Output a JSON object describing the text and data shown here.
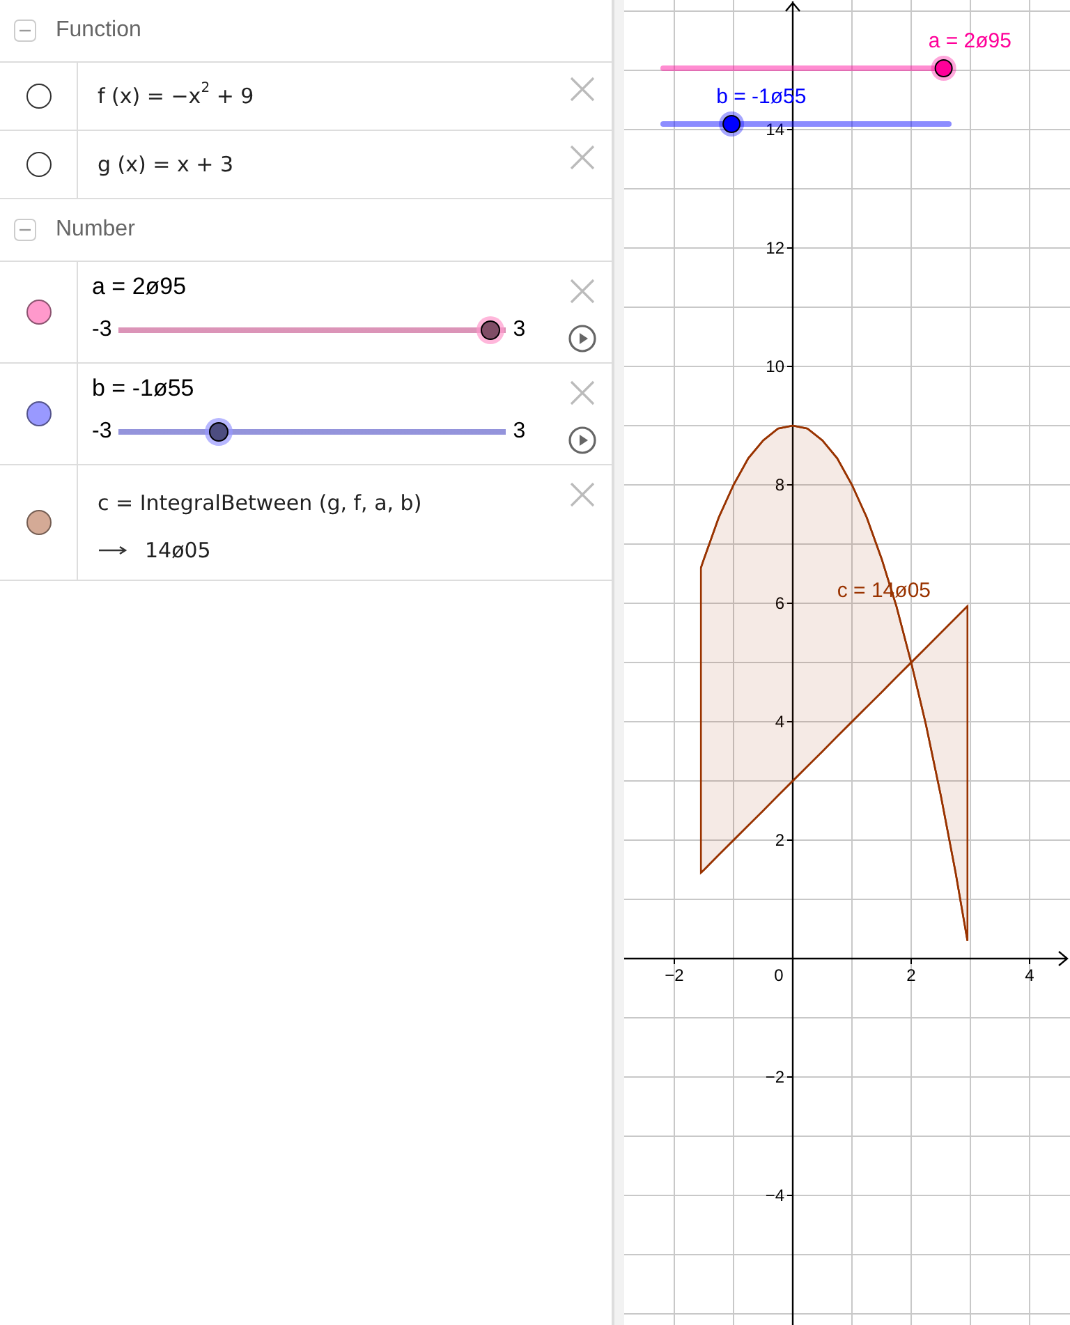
{
  "algebra": {
    "groups": [
      {
        "title": "Function",
        "expanded": true,
        "items": [
          {
            "kind": "function",
            "visible": false,
            "formula": "f (x) = −x$^{2}$ + 9"
          },
          {
            "kind": "function",
            "visible": false,
            "formula": "g (x) = x + 3"
          }
        ]
      },
      {
        "title": "Number",
        "expanded": true,
        "items": [
          {
            "kind": "slider",
            "visible": true,
            "color": "#ff99cc",
            "label": "a = 2ø95",
            "min": "-3",
            "max": "3",
            "level": 0.9917
          },
          {
            "kind": "slider",
            "visible": true,
            "color": "#9999ff",
            "label": "b = -1ø55",
            "min": "-3",
            "max": "3",
            "level": 0.2417
          },
          {
            "kind": "dependent",
            "visible": true,
            "color": "#d4aa96",
            "formula": "c = IntegralBetween (g, f, a, b)",
            "value": "14ø05"
          }
        ]
      }
    ]
  },
  "graphics": {
    "sliders": [
      {
        "label": "a = 2ø95",
        "color": "#ff0099",
        "level": 0.9917
      },
      {
        "label": "b = -1ø55",
        "color": "#0000ff",
        "level": 0.2417
      }
    ],
    "region_label": "c = 14ø05",
    "origin_label": "0",
    "chart_data": {
      "type": "line",
      "x": [
        -1.55,
        -1.5,
        -1.25,
        -1,
        -0.75,
        -0.5,
        -0.25,
        0,
        0.25,
        0.5,
        0.75,
        1,
        1.25,
        1.5,
        1.75,
        2,
        2.25,
        2.5,
        2.75,
        2.95
      ],
      "series": [
        {
          "color": "#993300",
          "values": [
            6.6,
            6.75,
            7.45,
            8,
            8.45,
            8.75,
            8.95,
            9,
            8.95,
            8.75,
            8.45,
            8,
            7.45,
            6.75,
            5.95,
            5,
            3.95,
            2.75,
            1.45,
            0.3
          ]
        },
        {
          "color": "#993300",
          "values": [
            1.45,
            1.5,
            1.75,
            2,
            2.25,
            2.5,
            2.75,
            3,
            3.25,
            3.5,
            3.75,
            4,
            4.25,
            4.5,
            4.75,
            5,
            5.25,
            5.5,
            5.75,
            5.95
          ]
        }
      ],
      "grid": true,
      "xlim": [
        -2.847,
        4.682
      ],
      "ylim": [
        -6.188,
        16.188
      ],
      "xticks": [
        {
          "value": -2,
          "label": "−2"
        },
        {
          "value": 2,
          "label": "2"
        },
        {
          "value": 4,
          "label": "4"
        }
      ],
      "yticks": [
        {
          "value": -4,
          "label": "−4"
        },
        {
          "value": -2,
          "label": "−2"
        },
        {
          "value": 2,
          "label": "2"
        },
        {
          "value": 4,
          "label": "4"
        },
        {
          "value": 6,
          "label": "6"
        },
        {
          "value": 8,
          "label": "8"
        },
        {
          "value": 10,
          "label": "10"
        },
        {
          "value": 12,
          "label": "12"
        },
        {
          "value": 14,
          "label": "14"
        }
      ]
    }
  }
}
